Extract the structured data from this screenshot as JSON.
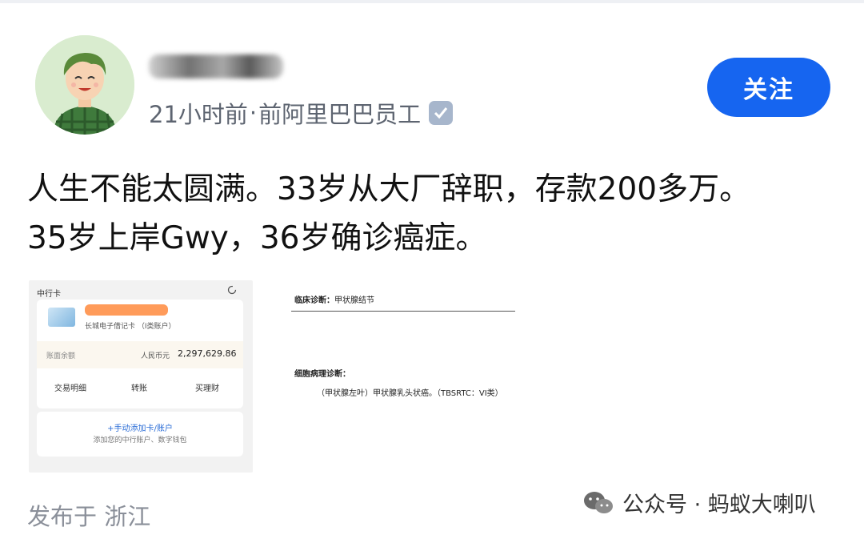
{
  "post": {
    "time": "21小时前",
    "separator": "·",
    "author_title": "前阿里巴巴员工",
    "follow_label": "关注",
    "lines": [
      "人生不能太圆满。33岁从大厂辞职，存款200多万。",
      "35岁上岸Gwy，36岁确诊癌症。"
    ],
    "location": "发布于 浙江"
  },
  "bank_image": {
    "header": "中行卡",
    "card_name": "长城电子借记卡  （I类账户）",
    "balance_label": "账面余额",
    "currency": "人民币元",
    "amount": "2,297,629.86",
    "actions": [
      "交易明细",
      "转账",
      "买理财"
    ],
    "add_label": "+手动添加卡/账户",
    "add_sub": "添加您的中行账户、数字钱包"
  },
  "diagnosis_image": {
    "clinical_label": "临床诊断：",
    "clinical_value": "甲状腺结节",
    "pathology_label": "细胞病理诊断：",
    "pathology_value": "（甲状腺左叶）甲状腺乳头状癌。（TBSRTC：VI类）"
  },
  "watermark": {
    "text": "公众号 · 蚂蚁大喇叭"
  },
  "colors": {
    "follow_bg": "#1665f0",
    "meta_text": "#5d6470",
    "badge": "#a7b6cc"
  }
}
